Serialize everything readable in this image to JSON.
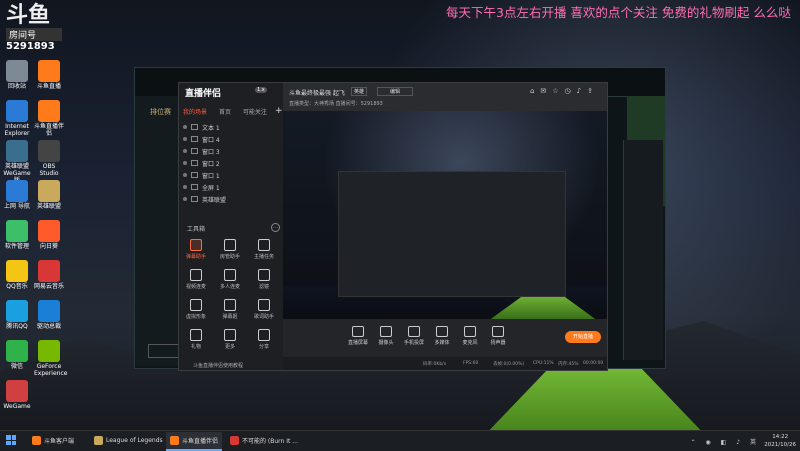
{
  "banner": "每天下午3点左右开播 喜欢的点个关注 免费的礼物刷起 么么哒",
  "logo": {
    "main_text": "斗鱼",
    "room_label": "房间号",
    "room_number": "5291893"
  },
  "desktop_icons": [
    {
      "label": "回收站",
      "color": "#7d8a96"
    },
    {
      "label": "斗鱼直播",
      "color": "#ff7a1a"
    },
    {
      "label": "Internet Explorer",
      "color": "#2b7bd6"
    },
    {
      "label": "斗鱼直播伴侣",
      "color": "#ff7a1a"
    },
    {
      "label": "英雄联盟WeGame版",
      "color": "#3a6e8f"
    },
    {
      "label": "OBS Studio",
      "color": "#444"
    },
    {
      "label": "上网 导航",
      "color": "#2b7bd6"
    },
    {
      "label": "英雄联盟",
      "color": "#c9a95b"
    },
    {
      "label": "软件管理",
      "color": "#3dbf6a"
    },
    {
      "label": "向日葵",
      "color": "#ff5a2a"
    },
    {
      "label": "QQ音乐",
      "color": "#f5c515"
    },
    {
      "label": "网易云音乐",
      "color": "#d93636"
    },
    {
      "label": "腾讯QQ",
      "color": "#1aa0e0"
    },
    {
      "label": "驱动总裁",
      "color": "#1a7fd6"
    },
    {
      "label": "微信",
      "color": "#2fb24a"
    },
    {
      "label": "GeForce Experience",
      "color": "#76b900"
    },
    {
      "label": "WeGame",
      "color": "#d04040"
    }
  ],
  "lol_window": {
    "left_title": "排位赛"
  },
  "assistant": {
    "app_name": "直播伴侣",
    "badge": "1.x",
    "tabs": [
      {
        "label": "我的场景",
        "active": true
      },
      {
        "label": "首页"
      },
      {
        "label": "可能关注"
      }
    ],
    "scenes": [
      "文本 1",
      "窗口 4",
      "窗口 3",
      "窗口 2",
      "窗口 1",
      "全屏 1",
      "英雄联盟"
    ],
    "tools_title": "工具箱",
    "tools": [
      {
        "label": "弹幕助手",
        "hot": true
      },
      {
        "label": "房管助手"
      },
      {
        "label": "主播任务"
      },
      {
        "label": "视频连麦"
      },
      {
        "label": "多人连麦"
      },
      {
        "label": "滤镜"
      },
      {
        "label": "虚拟形象"
      },
      {
        "label": "弹幕姬"
      },
      {
        "label": "歌词助手"
      },
      {
        "label": "礼物"
      },
      {
        "label": "更多"
      },
      {
        "label": "分享"
      }
    ],
    "bottom_note": "斗鱼直播伴侣使用教程",
    "header": {
      "title": "斗鱼最终极最强 起飞",
      "category": "英雄",
      "edit_label": "编辑",
      "sub": "直播类型：大神秀场  直播间号：5291893"
    },
    "header_icons": [
      "home-icon",
      "chat-icon",
      "gift-icon",
      "clock-icon",
      "bell-icon",
      "share-icon"
    ],
    "controls": [
      {
        "label": "直播屏幕"
      },
      {
        "label": "摄像头"
      },
      {
        "label": "手机投屏"
      },
      {
        "label": "多媒体"
      },
      {
        "label": "麦克风"
      },
      {
        "label": "扬声器"
      }
    ],
    "live_button": "开始直播",
    "status": {
      "bitrate": "码率:0Kb/s",
      "fps": "FPS:60",
      "loss": "丢帧:0(0.00%)",
      "cpu": "CPU:11%",
      "mem": "内存:45%",
      "time": "00:00:00"
    }
  },
  "taskbar": {
    "items": [
      {
        "label": "斗鱼客户端",
        "color": "#ff7a1a"
      },
      {
        "label": "League of Legends",
        "color": "#c9a95b"
      },
      {
        "label": "斗鱼直播伴侣",
        "color": "#ff7a1a",
        "active": true
      },
      {
        "label": "不可能的 (Burn It ...",
        "color": "#d93636"
      }
    ],
    "time": "14:22",
    "date": "2021/10/26"
  }
}
